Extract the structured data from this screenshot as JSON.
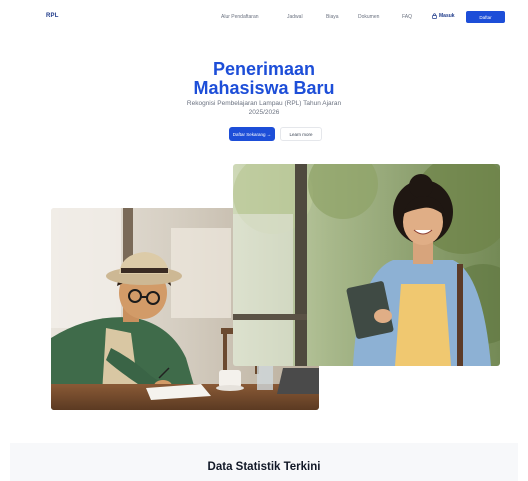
{
  "nav": {
    "logo": "RPL",
    "items": [
      "Alur Pendaftaran",
      "Jadwal",
      "Biaya",
      "Dokumen",
      "FAQ"
    ],
    "login_label": "Masuk",
    "register_label": "Daftar"
  },
  "hero": {
    "title_line1": "Penerimaan",
    "title_line2": "Mahasiswa Baru",
    "subtitle_line1": "Rekognisi Pembelajaran Lampau (RPL) Tahun Ajaran",
    "subtitle_line2": "2025/2026",
    "primary_button": "Daftar Sekarang →",
    "secondary_button": "Learn more"
  },
  "stats": {
    "title": "Data Statistik Terkini"
  },
  "icons": {
    "login": "lock-icon"
  },
  "colors": {
    "primary": "#1d4ed8",
    "navy": "#1e3a8a"
  }
}
